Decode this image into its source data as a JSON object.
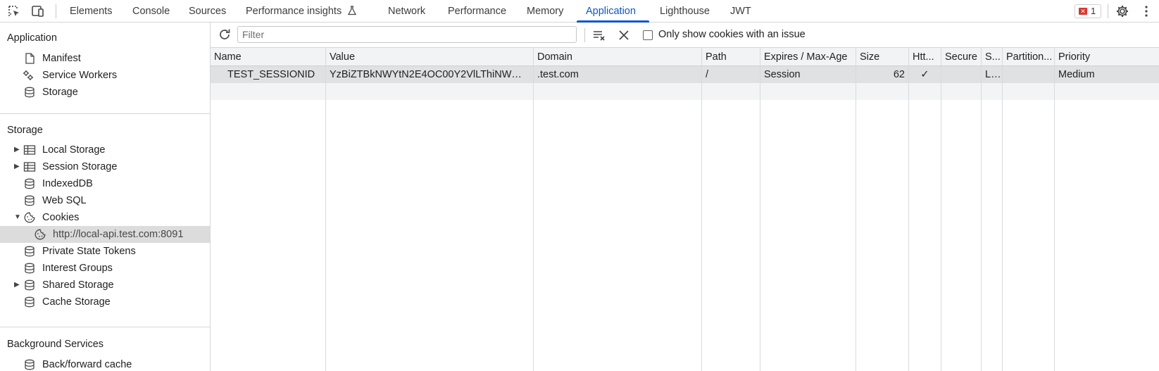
{
  "toolbar_tabs": [
    {
      "label": "Elements"
    },
    {
      "label": "Console"
    },
    {
      "label": "Sources"
    },
    {
      "label": "Performance insights"
    },
    {
      "label": "Network"
    },
    {
      "label": "Performance"
    },
    {
      "label": "Memory"
    },
    {
      "label": "Application"
    },
    {
      "label": "Lighthouse"
    },
    {
      "label": "JWT"
    }
  ],
  "active_tab": "Application",
  "error_count": "1",
  "colors": {
    "accent": "#0b57d0",
    "error": "#dc362e",
    "selected_row": "#dfe1e3"
  },
  "sidebar": {
    "application": {
      "title": "Application",
      "items": [
        {
          "label": "Manifest",
          "icon": "file-icon"
        },
        {
          "label": "Service Workers",
          "icon": "gears-icon"
        },
        {
          "label": "Storage",
          "icon": "database-icon"
        }
      ]
    },
    "storage": {
      "title": "Storage",
      "items": [
        {
          "label": "Local Storage",
          "icon": "table-icon",
          "expandable": "collapsed"
        },
        {
          "label": "Session Storage",
          "icon": "table-icon",
          "expandable": "collapsed"
        },
        {
          "label": "IndexedDB",
          "icon": "database-icon"
        },
        {
          "label": "Web SQL",
          "icon": "database-icon"
        },
        {
          "label": "Cookies",
          "icon": "cookie-icon",
          "expandable": "expanded"
        },
        {
          "label": "http://local-api.test.com:8091",
          "icon": "cookie-icon",
          "selected": true
        },
        {
          "label": "Private State Tokens",
          "icon": "database-icon"
        },
        {
          "label": "Interest Groups",
          "icon": "database-icon"
        },
        {
          "label": "Shared Storage",
          "icon": "database-icon",
          "expandable": "collapsed"
        },
        {
          "label": "Cache Storage",
          "icon": "database-icon"
        }
      ]
    },
    "background": {
      "title": "Background Services",
      "items": [
        {
          "label": "Back/forward cache",
          "icon": "database-icon"
        }
      ]
    }
  },
  "cookie_toolbar": {
    "filter_placeholder": "Filter",
    "only_issues_label": "Only show cookies with an issue",
    "only_issues_checked": false
  },
  "table": {
    "columns": [
      "Name",
      "Value",
      "Domain",
      "Path",
      "Expires / Max-Age",
      "Size",
      "Htt...",
      "Secure",
      "S...",
      "Partition...",
      "Priority"
    ],
    "rows": [
      {
        "name": "TEST_SESSIONID",
        "value": "YzBiZTBkNWYtN2E4OC00Y2VlLThiNWQtN...",
        "domain": ".test.com",
        "path": "/",
        "expires": "Session",
        "size": "62",
        "httponly": "✓",
        "secure": "",
        "samesite": "L...",
        "partition": "",
        "priority": "Medium"
      }
    ]
  }
}
